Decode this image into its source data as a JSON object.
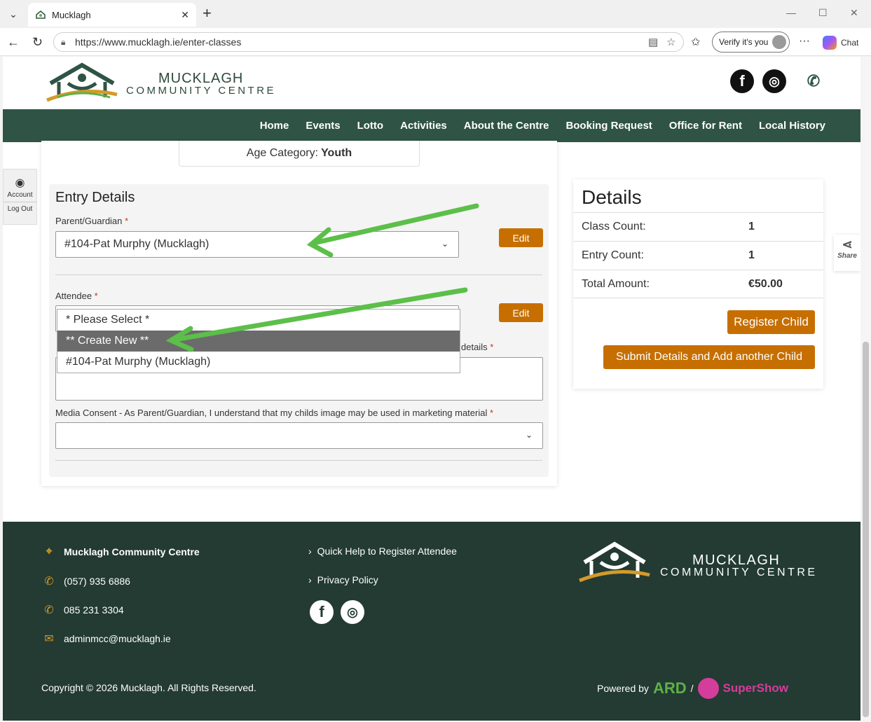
{
  "browser": {
    "tab_title": "Mucklagh",
    "url": "https://www.mucklagh.ie/enter-classes",
    "verify_label": "Verify it's you",
    "chat_label": "Chat"
  },
  "site": {
    "logo_line1": "MUCKLAGH",
    "logo_line2": "COMMUNITY CENTRE",
    "nav": [
      "Home",
      "Events",
      "Lotto",
      "Activities",
      "About the Centre",
      "Booking Request",
      "Office for Rent",
      "Local History"
    ]
  },
  "side": {
    "account": "Account",
    "logout": "Log Out",
    "share": "Share"
  },
  "form": {
    "age_label": "Age Category:",
    "age_value": "Youth",
    "section_title": "Entry Details",
    "parent_label": "Parent/Guardian",
    "parent_value": "#104-Pat Murphy (Mucklagh)",
    "edit_label": "Edit",
    "attendee_label": "Attendee",
    "details_label_tail": "details",
    "attendee_options": [
      "* Please Select *",
      "** Create New **",
      "#104-Pat Murphy (Mucklagh)"
    ],
    "media_label": "Media Consent - As Parent/Guardian, I understand that my childs image may be used in marketing material",
    "required_mark": "*"
  },
  "details": {
    "title": "Details",
    "rows": [
      {
        "key": "Class Count:",
        "value": "1"
      },
      {
        "key": "Entry Count:",
        "value": "1"
      },
      {
        "key": "Total Amount:",
        "value": "€50.00"
      }
    ],
    "register_btn": "Register Child",
    "submit_btn": "Submit Details and Add another Child"
  },
  "footer": {
    "org_name": "Mucklagh Community Centre",
    "phone1": "(057) 935 6886",
    "phone2": "085 231 3304",
    "email": "adminmcc@mucklagh.ie",
    "link1": "Quick Help to Register Attendee",
    "link2": "Privacy Policy",
    "logo_line1": "MUCKLAGH",
    "logo_line2": "COMMUNITY CENTRE",
    "copyright": "Copyright © 2026 Mucklagh. All Rights Reserved.",
    "powered_by": "Powered by",
    "ard": "ARD",
    "separator": "/",
    "supershow": "SuperShow"
  },
  "colors": {
    "nav_green": "#2f5446",
    "footer_green": "#233b32",
    "button_orange": "#c66f00",
    "arrow_green": "#5cbf4a"
  }
}
